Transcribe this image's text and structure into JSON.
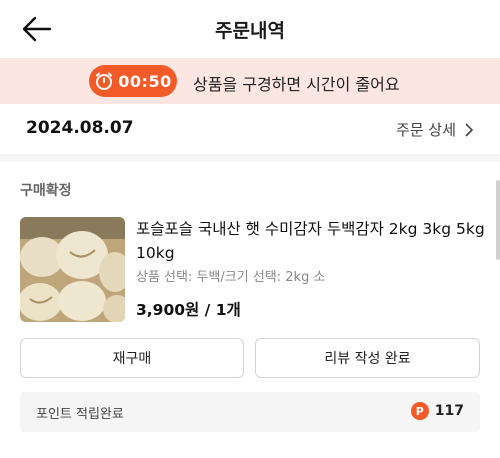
{
  "header": {
    "title": "주문내역",
    "back_icon": "arrow-left-icon"
  },
  "banner": {
    "timer": "00:50",
    "message": "상품을 구경하면 시간이 줄어요",
    "timer_icon": "stopwatch-icon",
    "accent_color": "#f25a27",
    "background": "#fbe6e2"
  },
  "order": {
    "date": "2024.08.07",
    "detail_link": "주문 상세",
    "status": "구매확정",
    "product": {
      "name": "포슬포슬 국내산 햇 수미감자 두백감자 2kg 3kg 5kg 10kg",
      "option": "상품 선택: 두백/크기 선택: 2kg 소",
      "price": "3,900원 / 1개"
    },
    "buttons": {
      "rebuy": "재구매",
      "review": "리뷰 작성 완료"
    },
    "points": {
      "label": "포인트 적립완료",
      "badge": "P",
      "value": "117"
    }
  }
}
